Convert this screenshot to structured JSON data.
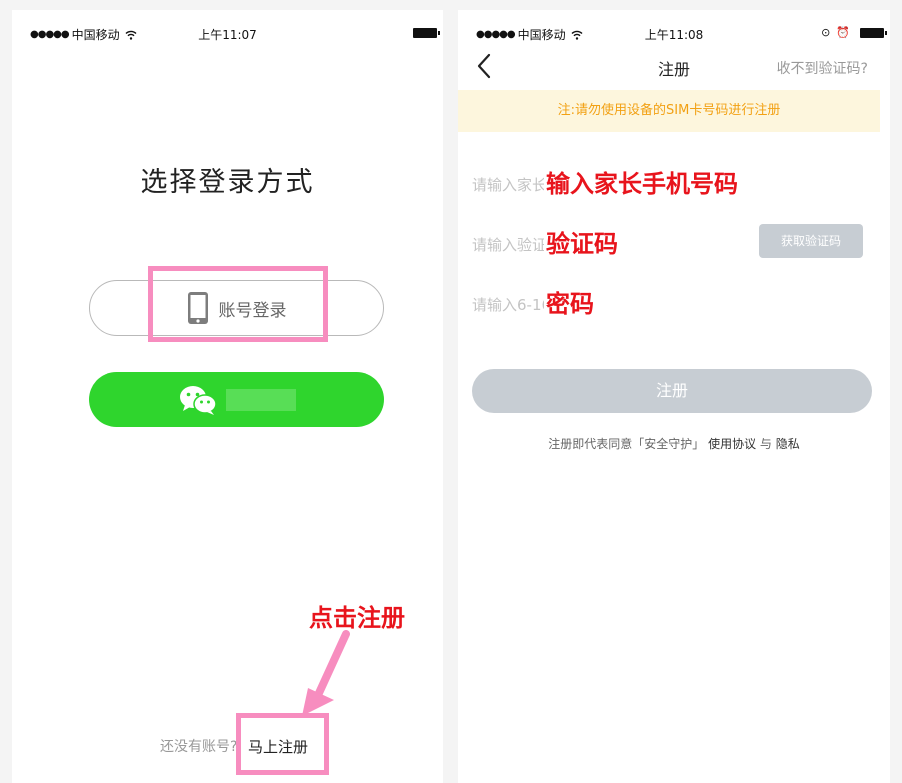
{
  "left": {
    "status": {
      "carrier": "中国移动",
      "time": "上午11:07"
    },
    "title": "选择登录方式",
    "account_login_label": "账号登录",
    "annotation_click": "点击注册",
    "register_prompt": "还没有账号?",
    "register_link": "马上注册",
    "highlight_color": "#f78dbf",
    "wechat_color": "#2fd52d"
  },
  "right": {
    "status": {
      "carrier": "中国移动",
      "time": "上午11:08"
    },
    "nav": {
      "back_icon": "chevron-left-icon",
      "title": "注册",
      "help": "收不到验证码?"
    },
    "notice": "注:请勿使用设备的SIM卡号码进行注册",
    "fields": {
      "phone": {
        "placeholder": "请输入家长手机号码",
        "annotation": "输入家长手机号码"
      },
      "code": {
        "placeholder": "请输入验证码",
        "annotation": "验证码"
      },
      "password": {
        "placeholder": "请输入6-16位密码",
        "annotation": "密码"
      }
    },
    "get_code_button": "获取验证码",
    "submit_button": "注册",
    "terms": {
      "prefix": "注册即代表同意「安全守护」",
      "agreement": "使用协议",
      "and": "与",
      "privacy": "隐私"
    },
    "notice_text_color": "#f2a114",
    "annotation_color": "#e8141c"
  }
}
